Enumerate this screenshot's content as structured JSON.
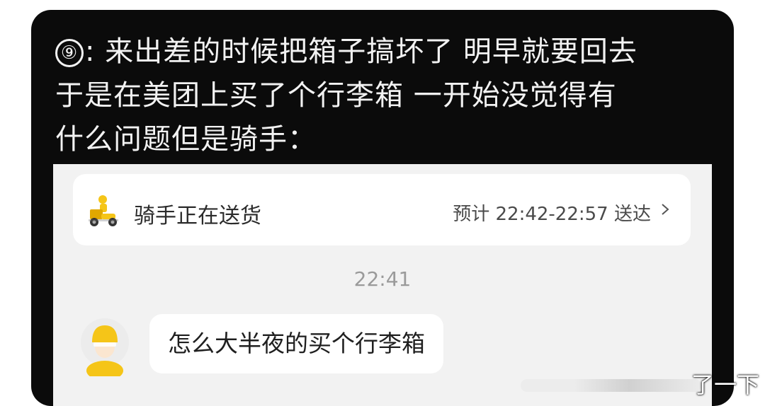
{
  "post": {
    "number_icon": "⑨",
    "lines": [
      ": 来出差的时候把箱子搞坏了 明早就要回去",
      "于是在美团上买了个行李箱 一开始没觉得有",
      "什么问题但是骑手："
    ]
  },
  "order_status": {
    "icon": "delivery-rider-icon",
    "label": "骑手正在送货",
    "eta": "预计 22:42-22:57 送达",
    "chevron": "chevron-right-icon"
  },
  "chat": {
    "timestamp": "22:41",
    "messages": [
      {
        "sender_icon": "rider-avatar-icon",
        "text": "怎么大半夜的买个行李箱"
      }
    ]
  },
  "watermark": {
    "text": "了一下"
  },
  "colors": {
    "post_background": "#0b0b0b",
    "post_text": "#f2f2f2",
    "screenshot_background": "#f2f2f2",
    "accent_yellow": "#f5c518"
  }
}
